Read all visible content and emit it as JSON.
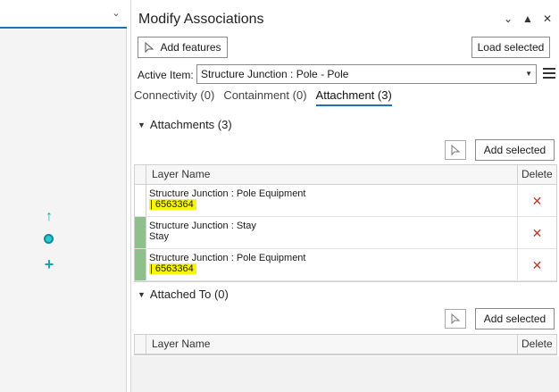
{
  "panel": {
    "title": "Modify Associations",
    "add_features_label": "Add features",
    "load_selected_label": "Load selected",
    "active_item_label": "Active Item:",
    "active_item_value": "Structure Junction : Pole - Pole"
  },
  "tabs": [
    {
      "label": "Connectivity (0)",
      "active": false
    },
    {
      "label": "Containment (0)",
      "active": false
    },
    {
      "label": "Attachment (3)",
      "active": true
    }
  ],
  "attachments": {
    "title": "Attachments (3)",
    "add_selected_label": "Add selected",
    "columns": {
      "name": "Layer Name",
      "delete": "Delete"
    },
    "rows": [
      {
        "line1": "Structure Junction : Pole Equipment",
        "line2": "| 6563364",
        "highlight": true,
        "selected": false
      },
      {
        "line1": "Structure Junction : Stay",
        "line2": "Stay",
        "highlight": false,
        "selected": true
      },
      {
        "line1": "Structure Junction : Pole Equipment",
        "line2": "| 6563364",
        "highlight": true,
        "selected": true
      }
    ]
  },
  "attached_to": {
    "title": "Attached To (0)",
    "add_selected_label": "Add selected",
    "columns": {
      "name": "Layer Name",
      "delete": "Delete"
    }
  },
  "colors": {
    "accent": "#1f72b8",
    "highlight": "#f8f315",
    "selected_row": "#8fbf8b",
    "delete": "#c0392b"
  }
}
